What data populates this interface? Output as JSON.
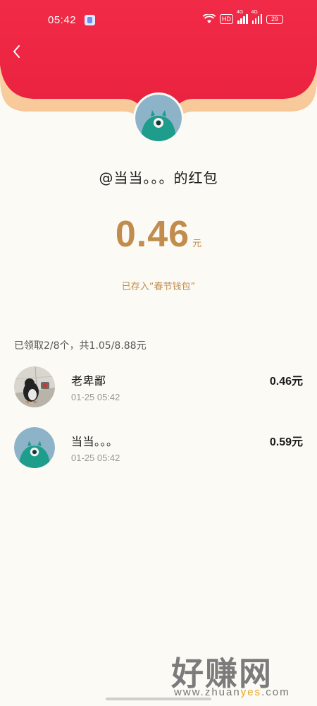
{
  "status_bar": {
    "time": "05:42",
    "hd": "HD",
    "net1": "4G",
    "net2": "4G",
    "battery": "29"
  },
  "header": {
    "back_icon": "chevron-left-icon",
    "bg_color": "#ef2744"
  },
  "red_packet": {
    "sender_title": "@当当。。。的红包",
    "amount": "0.46",
    "unit": "元",
    "saved_text": "已存入“春节钱包”",
    "amount_color": "#c18c4c"
  },
  "summary": "已领取2/8个，共1.05/8.88元",
  "records": [
    {
      "name": "老卑鄙",
      "time": "01-25 05:42",
      "amount": "0.46元",
      "avatar": "penguin-photo-avatar"
    },
    {
      "name": "当当。。。",
      "time": "01-25 05:42",
      "amount": "0.59元",
      "avatar": "teal-monster-avatar"
    }
  ],
  "watermark": {
    "cn": "好赚网",
    "url_prefix": "www.zhuan",
    "url_highlight": "yes",
    "url_suffix": ".com"
  }
}
